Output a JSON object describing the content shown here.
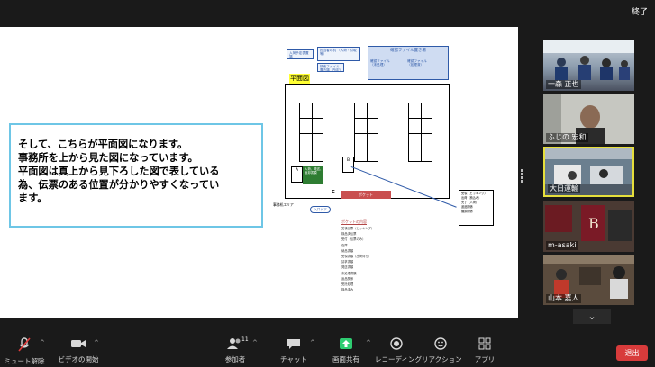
{
  "window": {
    "exit_fullscreen": "終了"
  },
  "slide": {
    "callout_lines": [
      "そして、こちらが平面図になります。",
      "事務所を上から見た図になっています。",
      "平面図は真上から見下ろした図で表している",
      "為、伝票のある位置が分かりやすくなってい",
      "ます。"
    ],
    "plan_label": "平面図",
    "blue_tags": [
      "入荷予定表置場",
      "担当者の机\n（入荷・引取等）",
      "検索ファイル\n置き場（所定）"
    ],
    "top_right_tag": {
      "title": "確認ファイル置き場",
      "line1": "確認ファイル\n（未処理）",
      "line2": "確認ファイル\n（処理済）"
    },
    "cabinet_a": "A",
    "cabinet_b": "B",
    "cabinet_c": "C",
    "green_box": "入荷、発送、\n返却書類",
    "pocket_bar": "ポケット",
    "pill_label": "入口ドア",
    "left_small": "事務机エリア",
    "side_list": [
      "受領（ピッキング）",
      "出荷（積込み）",
      "完了（入荷）",
      "返品関係",
      "棚卸関係"
    ],
    "pocket_list_title": "ポケットの内容",
    "pocket_list_items": [
      "受領伝票（ピッキング）",
      "検品済伝票",
      "受付（伝票のみ）",
      "在庫",
      "納品書類",
      "受領書類（出荷待ち）",
      "請求書類",
      "発送書類",
      "未処理書類",
      "返品関係",
      "受託処理",
      "検品済み"
    ]
  },
  "participants": [
    {
      "name": "一森 正也"
    },
    {
      "name": "ふじの 宏和"
    },
    {
      "name": "大日運輸"
    },
    {
      "name": "m-asaki"
    },
    {
      "name": "山本 嘉人"
    }
  ],
  "toolbar": {
    "items": [
      {
        "icon": "mic-muted-icon",
        "label": "ミュート解除"
      },
      {
        "icon": "video-icon",
        "label": "ビデオの開始"
      },
      {
        "icon": "participants-icon",
        "label": "参加者",
        "count": "11"
      },
      {
        "icon": "chat-icon",
        "label": "チャット"
      },
      {
        "icon": "share-screen-icon",
        "label": "画面共有"
      },
      {
        "icon": "record-icon",
        "label": "レコーディング"
      },
      {
        "icon": "reaction-icon",
        "label": "リアクション"
      },
      {
        "icon": "apps-icon",
        "label": "アプリ"
      }
    ],
    "leave": "退出"
  },
  "colors": {
    "callout_border": "#6ec6e6",
    "share_green": "#2ecc71",
    "leave_red": "#d83b3b",
    "active_speaker": "#e6df3c"
  }
}
